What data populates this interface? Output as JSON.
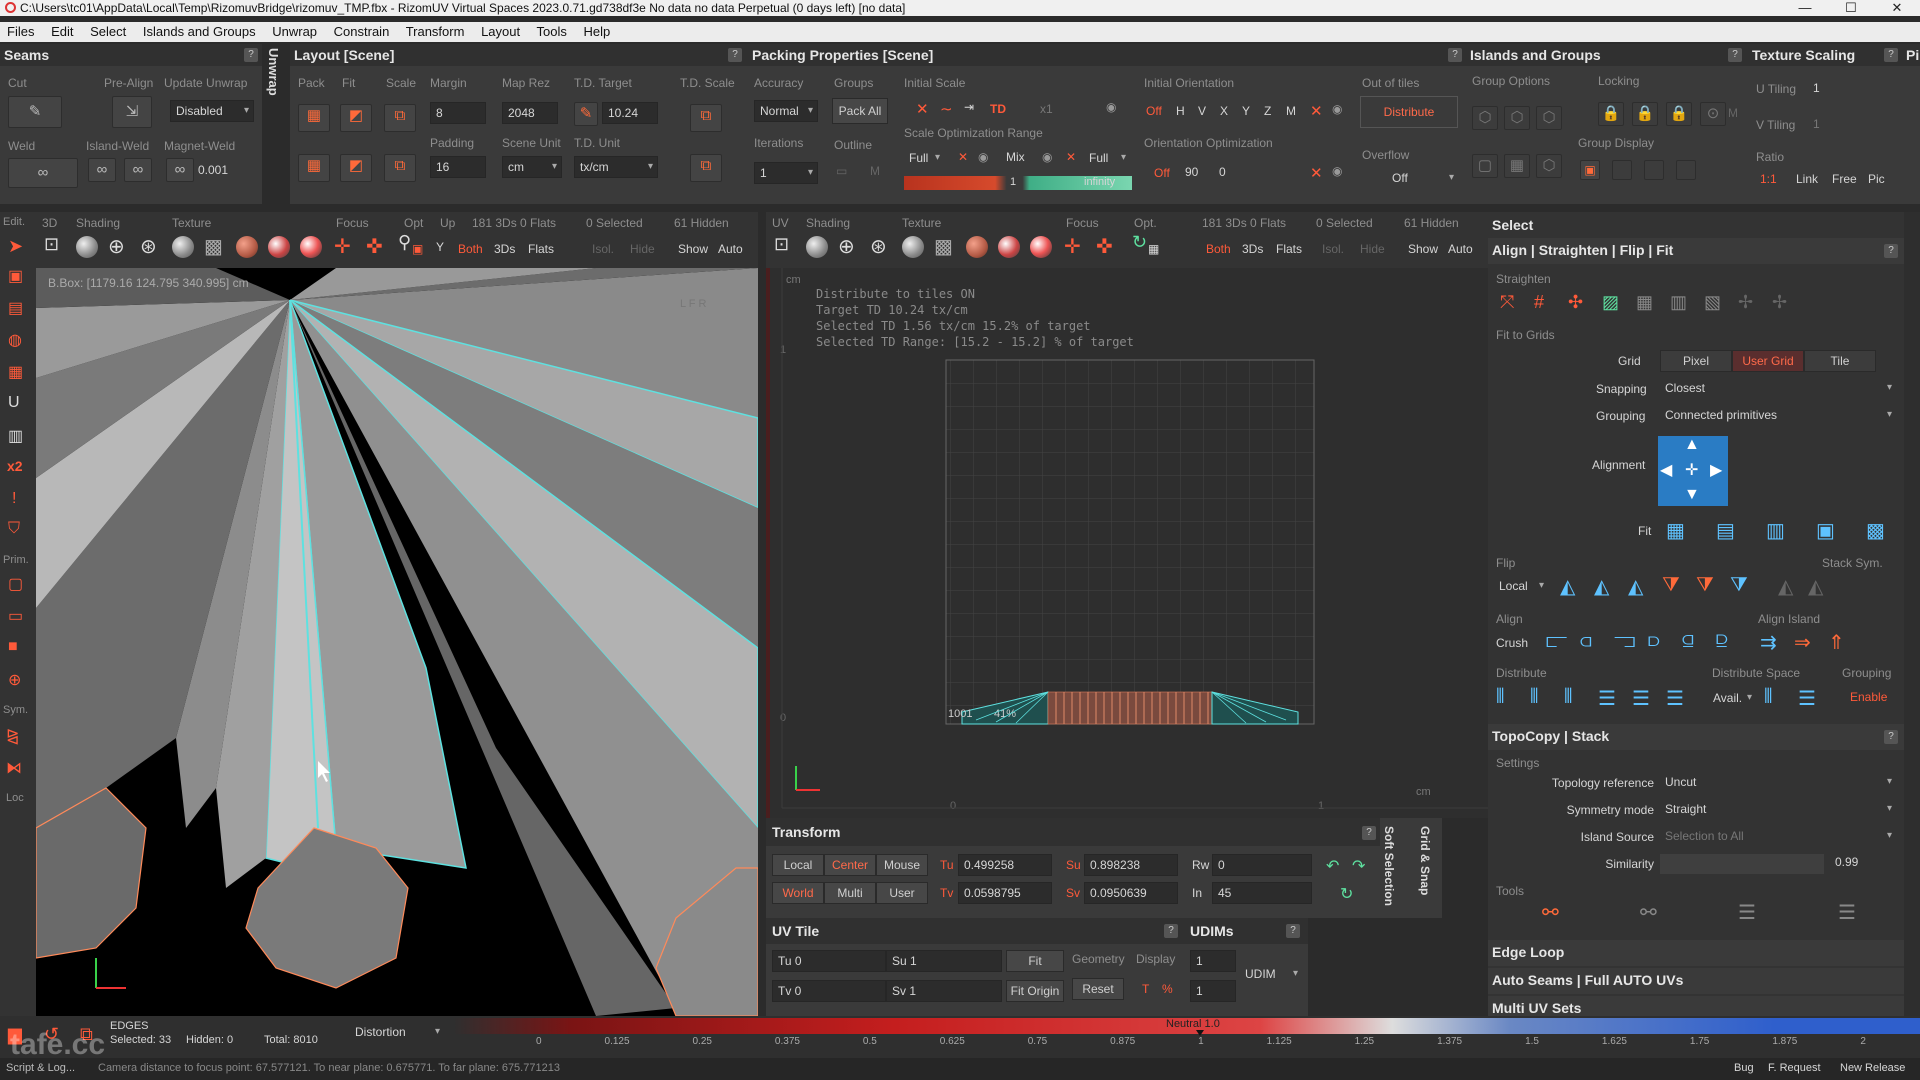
{
  "window": {
    "title": "C:\\Users\\tc01\\AppData\\Local\\Temp\\RizomuvBridge\\rizomuv_TMP.fbx - RizomUV  Virtual Spaces 2023.0.71.gd738df3e No data no data Perpetual  (0 days left) [no data]",
    "minimize": "—",
    "maximize": "☐",
    "close": "✕"
  },
  "menu": [
    "Files",
    "Edit",
    "Select",
    "Islands and Groups",
    "Unwrap",
    "Constrain",
    "Transform",
    "Layout",
    "Tools",
    "Help"
  ],
  "seams": {
    "title": "Seams",
    "cut": "Cut",
    "pre_align": "Pre-Align",
    "update_unwrap": "Update Unwrap",
    "update_value": "Disabled",
    "weld": "Weld",
    "island_weld": "Island-Weld",
    "magnet_weld": "Magnet-Weld",
    "magnet_value": "0.001"
  },
  "unwrap_tab": "Unwrap",
  "layout": {
    "title": "Layout [Scene]",
    "pack": "Pack",
    "fit": "Fit",
    "scale": "Scale",
    "margin": "Margin",
    "margin_value": "8",
    "map_rez": "Map Rez",
    "map_rez_value": "2048",
    "td_target": "T.D. Target",
    "td_target_value": "10.24",
    "td_scale": "T.D. Scale",
    "padding": "Padding",
    "padding_value": "16",
    "scene_unit": "Scene Unit",
    "scene_unit_value": "cm",
    "td_unit": "T.D. Unit",
    "td_unit_value": "tx/cm"
  },
  "packing": {
    "title": "Packing Properties [Scene]",
    "accuracy": "Accuracy",
    "accuracy_value": "Normal",
    "groups": "Groups",
    "pack_all": "Pack All",
    "initial_scale": "Initial Scale",
    "td": "TD",
    "x1": "x1",
    "iterations": "Iterations",
    "iterations_value": "1",
    "outline": "Outline",
    "m": "M",
    "scale_opt_range": "Scale Optimization Range",
    "full": "Full",
    "mix": "Mix",
    "full2": "Full",
    "range_value": "1",
    "infinity": "infinity",
    "initial_orientation": "Initial Orientation",
    "off": "Off",
    "h": "H",
    "v": "V",
    "x": "X",
    "y": "Y",
    "z": "Z",
    "m2": "M",
    "orientation_opt": "Orientation Optimization",
    "off2": "Off",
    "angle": "90",
    "angle2": "0",
    "out_of_tiles": "Out of tiles",
    "distribute": "Distribute",
    "overflow": "Overflow",
    "overflow_value": "Off"
  },
  "islands": {
    "title": "Islands and Groups",
    "group_options": "Group Options",
    "locking": "Locking",
    "m": "M",
    "group_display": "Group Display"
  },
  "texture_scaling": {
    "title": "Texture Scaling",
    "u_tiling": "U Tiling",
    "u_value": "1",
    "v_tiling": "V Tiling",
    "v_value": "1",
    "ratio": "Ratio",
    "ratio_value": "1:1",
    "link": "Link",
    "free": "Free",
    "pic": "Pic",
    "extra_tab": "Pi"
  },
  "viewport3d": {
    "edit": "Edit.",
    "mode": "3D",
    "shading": "Shading",
    "texture": "Texture",
    "focus": "Focus",
    "opt": "Opt",
    "up": "Up",
    "up_value": "Y",
    "stats": "181 3Ds 0 Flats",
    "selected": "0 Selected",
    "hidden": "61 Hidden",
    "both": "Both",
    "threeds": "3Ds",
    "flats": "Flats",
    "isol": "Isol.",
    "hide": "Hide",
    "show": "Show",
    "auto": "Auto",
    "bbox": "B.Box: [1179.16 124.795 340.995] cm",
    "corner_label": "L F R"
  },
  "left_tools": {
    "prim": "Prim.",
    "sym": "Sym.",
    "loc": "Loc",
    "x2": "x2"
  },
  "uvview": {
    "mode": "UV",
    "shading": "Shading",
    "texture": "Texture",
    "focus": "Focus",
    "opt": "Opt.",
    "stats": "181 3Ds 0 Flats",
    "selected": "0 Selected",
    "hidden": "61 Hidden",
    "both": "Both",
    "threeds": "3Ds",
    "flats": "Flats",
    "isol": "Isol.",
    "hide": "Hide",
    "show": "Show",
    "auto": "Auto",
    "unit": "cm",
    "unit2": "cm",
    "info": [
      "Distribute to tiles  ON",
      "Target TD  10.24 tx/cm",
      "Selected TD  1.56 tx/cm 15.2% of target",
      "Selected TD Range: [15.2 - 15.2] % of target"
    ],
    "tick_y1": "1",
    "tick_y0": "0",
    "tick_x0": "0",
    "tick_x1": "1",
    "tile_label": "1001",
    "tile_percent": "41%"
  },
  "transform": {
    "title": "Transform",
    "local": "Local",
    "center": "Center",
    "mouse": "Mouse",
    "world": "World",
    "multi": "Multi",
    "user": "User",
    "tu": "Tu",
    "tu_value": "0.499258",
    "tv": "Tv",
    "tv_value": "0.0598795",
    "su": "Su",
    "su_value": "0.898238",
    "sv": "Sv",
    "sv_value": "0.0950639",
    "rw": "Rw",
    "rw_value": "0",
    "in": "In",
    "in_value": "45"
  },
  "side_tabs": {
    "soft_selection": "Soft Selection",
    "grid_snap": "Grid & Snap"
  },
  "uvtile": {
    "title": "UV Tile",
    "tu": "Tu 0",
    "tv": "Tv 0",
    "su": "Su 1",
    "sv": "Sv 1",
    "fit": "Fit",
    "fit_origin": "Fit Origin",
    "geometry": "Geometry",
    "display": "Display",
    "reset": "Reset",
    "t": "T",
    "pct": "%"
  },
  "udims": {
    "title": "UDIMs",
    "v1": "1",
    "v2": "1",
    "udim": "UDIM"
  },
  "select": {
    "title": "Select",
    "align_title": "Align | Straighten | Flip | Fit",
    "straighten": "Straighten",
    "fit_to_grids": "Fit to Grids",
    "grid": "Grid",
    "pixel": "Pixel",
    "user_grid": "User Grid",
    "tile": "Tile",
    "snapping": "Snapping",
    "snapping_value": "Closest",
    "grouping": "Grouping",
    "grouping_value": "Connected primitives",
    "alignment": "Alignment",
    "fit": "Fit",
    "flip": "Flip",
    "flip_mode": "Local",
    "stack_sym": "Stack Sym.",
    "align": "Align",
    "crush": "Crush",
    "align_island": "Align Island",
    "distribute": "Distribute",
    "distribute_space": "Distribute Space",
    "avail": "Avail.",
    "grouping2": "Grouping",
    "enable": "Enable"
  },
  "topocopy": {
    "title": "TopoCopy | Stack",
    "settings": "Settings",
    "topology_reference": "Topology reference",
    "topology_value": "Uncut",
    "symmetry_mode": "Symmetry mode",
    "symmetry_value": "Straight",
    "island_source": "Island Source",
    "island_source_value": "Selection to All",
    "similarity": "Similarity",
    "similarity_value": "0.99",
    "tools": "Tools"
  },
  "more_sections": [
    "Edge Loop",
    "Auto Seams | Full AUTO UVs",
    "Multi UV Sets"
  ],
  "status": {
    "edges": "EDGES",
    "selected": "Selected: 33",
    "hidden": "Hidden: 0",
    "total": "Total: 8010",
    "distortion": "Distortion",
    "neutral": "Neutral 1.0",
    "ticks": [
      "0",
      "0.125",
      "0.25",
      "0.375",
      "0.5",
      "0.625",
      "0.75",
      "0.875",
      "1",
      "1.125",
      "1.25",
      "1.375",
      "1.5",
      "1.625",
      "1.75",
      "1.875",
      "2"
    ],
    "script_log": "Script & Log...",
    "camera": "Camera distance to focus point: 67.577121. To near plane: 0.675771. To far plane: 675.771213",
    "bug": "Bug",
    "feature_request": "F. Request",
    "new_release": "New Release",
    "watermark": "tafe.cc"
  },
  "colors": {
    "accent": "#ff5a3a",
    "uv_edge": "#5ee1e0",
    "panel": "#3a3a3a"
  }
}
